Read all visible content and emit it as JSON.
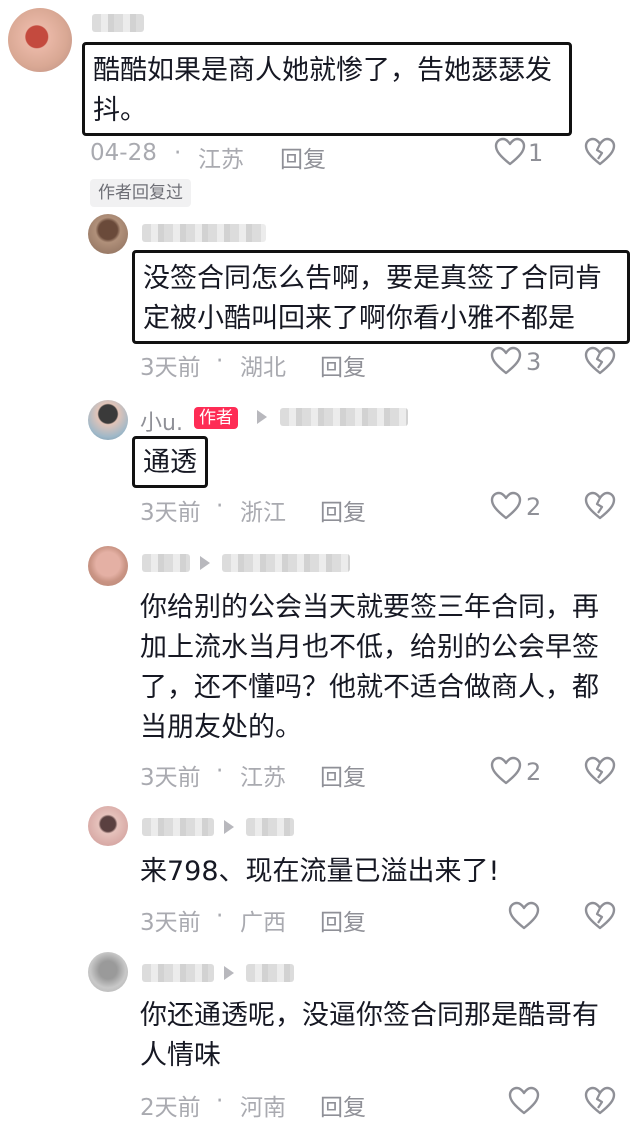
{
  "accent": "#fe2c55",
  "comments": [
    {
      "text": "酷酷如果是商人她就惨了，告她瑟瑟发\n抖。",
      "date": "04-28",
      "location": "江苏",
      "reply_label": "回复",
      "likes": "1",
      "author_replied_tag": "作者回复过"
    },
    {
      "text": "没签合同怎么告啊，要是真签了合同肯\n定被小酷叫回来了啊你看小雅不都是",
      "date": "3天前",
      "location": "湖北",
      "reply_label": "回复",
      "likes": "3"
    },
    {
      "username": "小u.",
      "badge": "作者",
      "text": "通透",
      "date": "3天前",
      "location": "浙江",
      "reply_label": "回复",
      "likes": "2"
    },
    {
      "text": "你给别的公会当天就要签三年合同，再\n加上流水当月也不低，给别的公会早签\n了，还不懂吗？他就不适合做商人，都\n当朋友处的。",
      "date": "3天前",
      "location": "江苏",
      "reply_label": "回复",
      "likes": "2"
    },
    {
      "text": "来798、现在流量已溢出来了!",
      "date": "3天前",
      "location": "广西",
      "reply_label": "回复",
      "likes": ""
    },
    {
      "text": "你还通透呢，没逼你签合同那是酷哥有\n人情味",
      "date": "2天前",
      "location": "河南",
      "reply_label": "回复",
      "likes": ""
    }
  ],
  "icons": {
    "like": "heart-outline-icon",
    "dislike": "broken-heart-icon",
    "reply_to": "triangle-arrow-icon"
  }
}
